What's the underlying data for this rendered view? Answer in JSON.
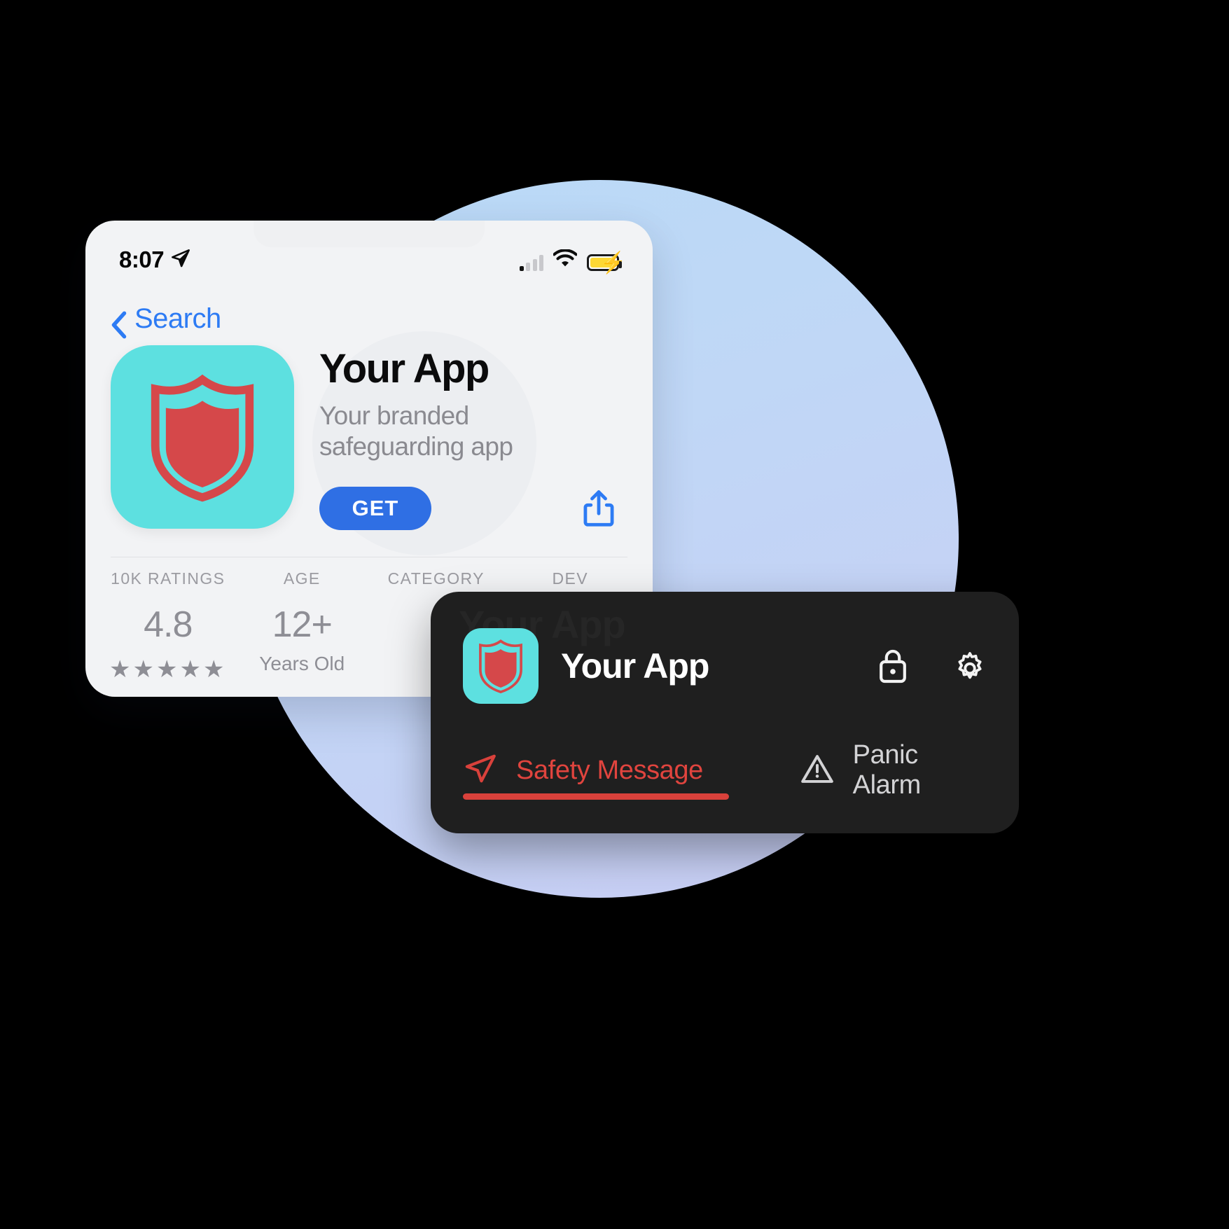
{
  "phone": {
    "status_bar": {
      "time": "8:07",
      "location_icon": "location-arrow-icon",
      "signal_icon": "cellular-signal-icon",
      "wifi_icon": "wifi-icon",
      "battery_icon": "battery-charging-icon"
    },
    "nav": {
      "back_icon": "chevron-left-icon",
      "back_label": "Search"
    },
    "app": {
      "icon_name": "shield-app-icon",
      "title": "Your App",
      "subtitle": "Your branded safeguarding app",
      "get_label": "GET",
      "share_icon": "share-icon"
    },
    "stats": [
      {
        "caption": "10K RATINGS",
        "value": "4.8",
        "sub": "",
        "stars": "★★★★★"
      },
      {
        "caption": "AGE",
        "value": "12+",
        "sub": "Years Old",
        "stars": ""
      },
      {
        "caption": "CATEGORY",
        "value": "",
        "sub": "",
        "stars": ""
      },
      {
        "caption": "DEV",
        "value": "",
        "sub": "",
        "stars": ""
      }
    ]
  },
  "widget": {
    "icon_name": "shield-app-icon",
    "title": "Your App",
    "watermark": "Your App",
    "lock_icon": "lock-icon",
    "settings_icon": "gear-icon",
    "actions": [
      {
        "icon": "paper-plane-icon",
        "label": "Safety Message"
      },
      {
        "icon": "warning-triangle-icon",
        "label": "Panic Alarm"
      }
    ]
  },
  "colors": {
    "accent_blue": "#2f6fe4",
    "app_teal": "#5de0e0",
    "shield_red": "#d5484a",
    "alert_red": "#d9413b",
    "widget_bg": "#1f1f1f",
    "battery_yellow": "#fdd835"
  }
}
